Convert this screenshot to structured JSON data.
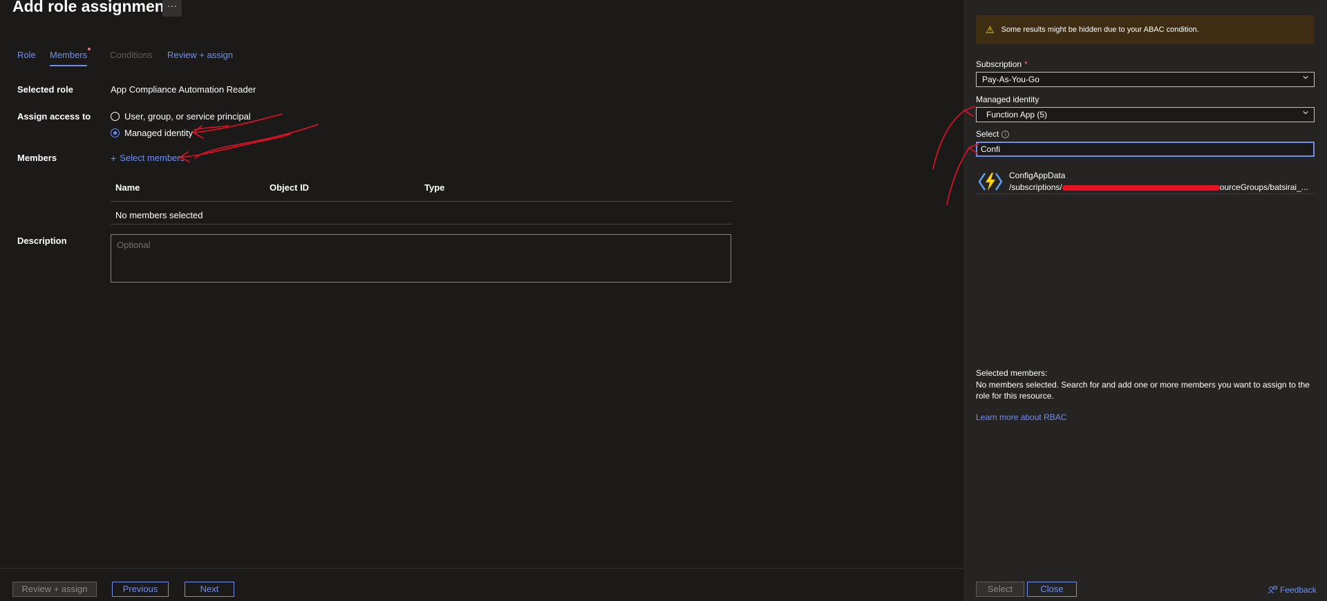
{
  "page": {
    "title": "Add role assignment",
    "more_label": "···"
  },
  "tabs": [
    {
      "label": "Role",
      "state": "normal"
    },
    {
      "label": "Members",
      "state": "active",
      "required": true
    },
    {
      "label": "Conditions",
      "state": "disabled"
    },
    {
      "label": "Review + assign",
      "state": "normal"
    }
  ],
  "form": {
    "selected_role_label": "Selected role",
    "selected_role_value": "App Compliance Automation Reader",
    "assign_access_label": "Assign access to",
    "options": [
      {
        "label": "User, group, or service principal",
        "checked": false
      },
      {
        "label": "Managed identity",
        "checked": true
      }
    ],
    "members_label": "Members",
    "select_members_link": "Select members",
    "table": {
      "columns": [
        "Name",
        "Object ID",
        "Type"
      ],
      "empty": "No members selected"
    },
    "description_label": "Description",
    "description_placeholder": "Optional"
  },
  "footer": {
    "review_assign": "Review + assign",
    "previous": "Previous",
    "next": "Next"
  },
  "panel": {
    "warning": "Some results might be hidden due to your ABAC condition.",
    "subscription_label": "Subscription",
    "subscription_value": "Pay-As-You-Go",
    "managed_identity_label": "Managed identity",
    "managed_identity_value": "Function App (5)",
    "select_label": "Select",
    "search_value": "Confi",
    "result": {
      "name": "ConfigAppData",
      "path_start": "/subscriptions/",
      "path_end": "ourceGroups/batsirai_..."
    },
    "selected_members_heading": "Selected members:",
    "selected_members_text": "No members selected. Search for and add one or more members you want to assign to the role for this resource.",
    "learn_more": "Learn more about RBAC",
    "select_button": "Select",
    "close_button": "Close",
    "feedback": "Feedback"
  },
  "colors": {
    "accent": "#6f8ff5",
    "background": "#1b1a19",
    "panel": "#252423",
    "warning_bg": "#3f2d13",
    "annotation": "#e81123"
  }
}
